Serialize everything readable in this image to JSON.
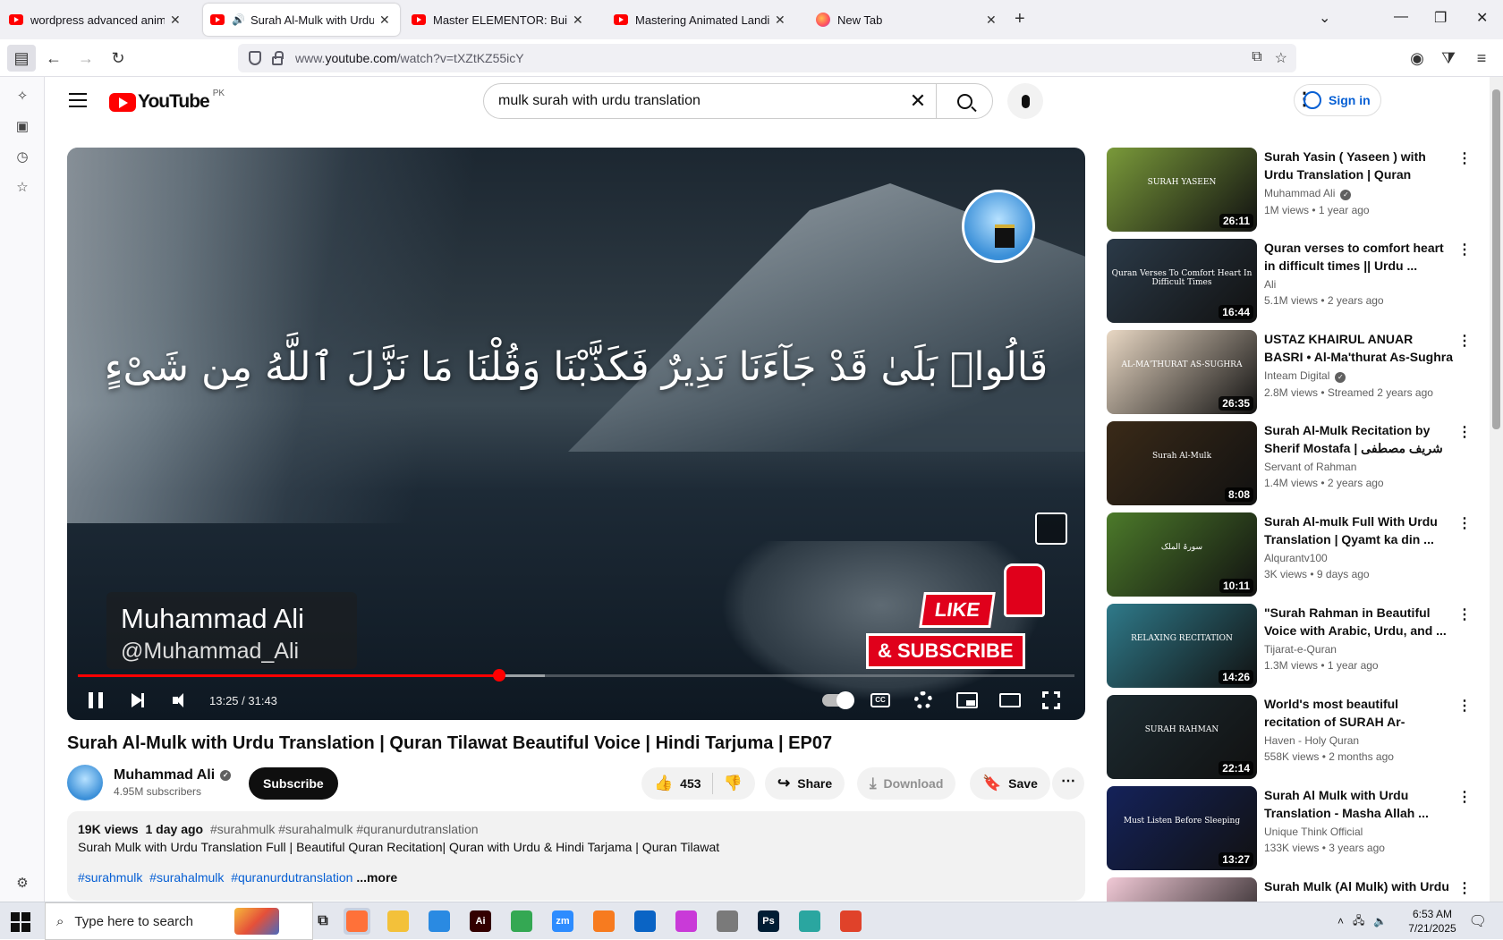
{
  "browser": {
    "tabs": [
      {
        "title": "wordpress advanced animation",
        "active": false,
        "favicon": "youtube-icon"
      },
      {
        "title": "Surah Al-Mulk with Urdu Tr",
        "active": true,
        "favicon": "youtube-icon",
        "playing": true
      },
      {
        "title": "Master ELEMENTOR: Build a Res",
        "active": false,
        "favicon": "youtube-icon"
      },
      {
        "title": "Mastering Animated Landing Pa",
        "active": false,
        "favicon": "youtube-icon"
      },
      {
        "title": "New Tab",
        "active": false,
        "favicon": "firefox-icon"
      }
    ],
    "url_prefix": "www.",
    "url_domain": "youtube.com",
    "url_path": "/watch?v=tXZtKZ55icY"
  },
  "yt": {
    "country": "PK",
    "logo_text": "YouTube",
    "search_query": "mulk surah with urdu translation",
    "signin_label": "Sign in"
  },
  "player": {
    "verse_text": "قَالُوا۟ بَلَىٰ قَدْ جَآءَنَا نَذِيرٌ فَكَذَّبْنَا وَقُلْنَا مَا نَزَّلَ ٱللَّهُ مِن شَىْءٍ",
    "overlay_name": "Muhammad Ali",
    "overlay_handle": "@Muhammad_Ali",
    "promo_like": "LIKE",
    "promo_subscribe": "& SUBSCRIBE",
    "time_display": "13:25 / 31:43",
    "played_fraction": 0.4226,
    "buffered_fraction": 0.4687,
    "cc_label": "CC"
  },
  "video": {
    "title": "Surah Al-Mulk with Urdu Translation | Quran Tilawat Beautiful Voice | Hindi Tarjuma | EP07",
    "channel": "Muhammad Ali",
    "subscribers": "4.95M subscribers",
    "subscribe_label": "Subscribe",
    "likes": "453",
    "share_label": "Share",
    "download_label": "Download",
    "save_label": "Save",
    "views": "19K views",
    "date": "1 day ago",
    "tags_line": "#surahmulk #surahalmulk #quranurdutranslation",
    "description": "Surah Mulk with Urdu Translation Full | Beautiful Quran Recitation| Quran with Urdu & Hindi Tarjama | Quran Tilawat",
    "hashtags": [
      "#surahmulk",
      "#surahalmulk",
      "#quranurdutranslation"
    ],
    "more_label": "...more"
  },
  "recommendations": [
    {
      "title": "Surah Yasin ( Yaseen ) with Urdu Translation | Quran Tilaw...",
      "channel": "Muhammad Ali",
      "verified": true,
      "meta": "1M views • 1 year ago",
      "duration": "26:11",
      "thumb_text": "SURAH YASEEN",
      "bg": "#7a9a3a"
    },
    {
      "title": "Quran verses to comfort heart in difficult times || Urdu ...",
      "channel": "Ali",
      "verified": false,
      "meta": "5.1M views • 2 years ago",
      "duration": "16:44",
      "thumb_text": "Quran Verses To Comfort Heart In Difficult Times",
      "bg": "#2b3a48"
    },
    {
      "title": "USTAZ KHAIRUL ANUAR BASRI • Al-Ma'thurat As-Sughra ...",
      "channel": "Inteam Digital",
      "verified": true,
      "meta": "2.8M views • Streamed 2 years ago",
      "duration": "26:35",
      "thumb_text": "AL-MA'THURAT AS-SUGHRA",
      "bg": "#e9d8c4"
    },
    {
      "title": "Surah Al-Mulk Recitation by Sherif Mostafa | شريف مصطفى",
      "channel": "Servant of Rahman",
      "verified": false,
      "meta": "1.4M views • 2 years ago",
      "duration": "8:08",
      "thumb_text": "Surah Al-Mulk",
      "bg": "#3a2a18"
    },
    {
      "title": "Surah Al-mulk Full With Urdu Translation | Qyamt ka din ...",
      "channel": "Alqurantv100",
      "verified": false,
      "meta": "3K views • 9 days ago",
      "duration": "10:11",
      "thumb_text": "سورۃ الملک",
      "bg": "#4c7a2a"
    },
    {
      "title": "\"Surah Rahman in Beautiful Voice with Arabic, Urdu, and ...",
      "channel": "Tijarat-e-Quran",
      "verified": false,
      "meta": "1.3M views • 1 year ago",
      "duration": "14:26",
      "thumb_text": "RELAXING RECITATION",
      "bg": "#2f7a8a"
    },
    {
      "title": "World's most beautiful recitation of SURAH Ar-Rahma...",
      "channel": "Haven - Holy Quran",
      "verified": false,
      "meta": "558K views • 2 months ago",
      "duration": "22:14",
      "thumb_text": "SURAH RAHMAN",
      "bg": "#1c2a30"
    },
    {
      "title": "Surah Al Mulk with Urdu Translation - Masha Allah ...",
      "channel": "Unique Think Official",
      "verified": false,
      "meta": "133K views • 3 years ago",
      "duration": "13:27",
      "thumb_text": "Must Listen Before Sleeping",
      "bg": "#14225a"
    },
    {
      "title": "Surah Mulk (Al Mulk) with Urdu",
      "channel": "",
      "verified": false,
      "meta": "",
      "duration": "",
      "thumb_text": "",
      "bg": "#f1c9d6"
    }
  ],
  "taskbar": {
    "search_placeholder": "Type here to search",
    "time": "6:53 AM",
    "date": "7/21/2025",
    "apps": [
      {
        "name": "firefox-app",
        "label": "",
        "color": "#ff7139",
        "active": true
      },
      {
        "name": "file-explorer-app",
        "label": "",
        "color": "#f3c13a",
        "active": false
      },
      {
        "name": "vscode-app",
        "label": "",
        "color": "#2a8ae2",
        "active": false
      },
      {
        "name": "illustrator-app",
        "label": "Ai",
        "color": "#330000",
        "active": false
      },
      {
        "name": "chrome-app",
        "label": "",
        "color": "#34a853",
        "active": false
      },
      {
        "name": "zoom-app",
        "label": "zm",
        "color": "#2d8cff",
        "active": false
      },
      {
        "name": "xampp-app",
        "label": "",
        "color": "#f77b1f",
        "active": false
      },
      {
        "name": "outlook-app",
        "label": "",
        "color": "#0a64c5",
        "active": false
      },
      {
        "name": "pixelmator-app",
        "label": "",
        "color": "#c93ad8",
        "active": false
      },
      {
        "name": "pen-tool-app",
        "label": "",
        "color": "#7a7a7a",
        "active": false
      },
      {
        "name": "photoshop-app",
        "label": "Ps",
        "color": "#001d34",
        "active": false
      },
      {
        "name": "sketch-app",
        "label": "",
        "color": "#2aa6a0",
        "active": false
      },
      {
        "name": "figma-app",
        "label": "",
        "color": "#e0422a",
        "active": false
      }
    ]
  }
}
